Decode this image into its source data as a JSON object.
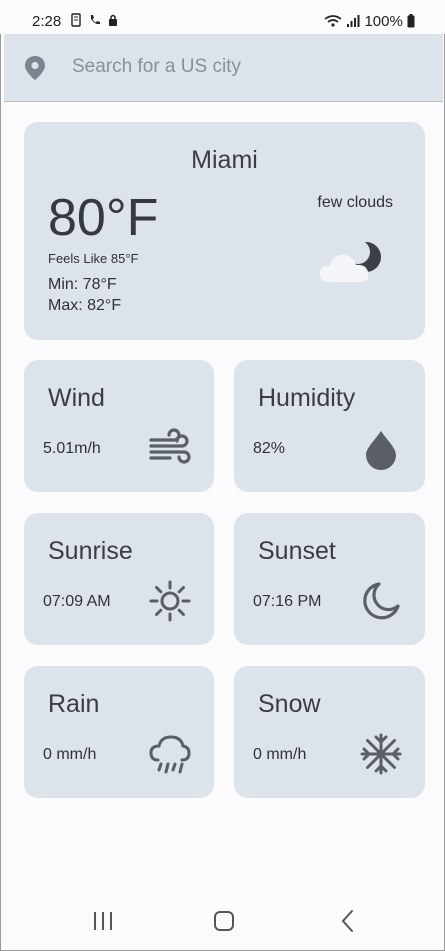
{
  "status_bar": {
    "time": "2:28",
    "battery": "100%"
  },
  "search": {
    "placeholder": "Search for a US city",
    "value": ""
  },
  "current": {
    "city": "Miami",
    "temperature": "80°F",
    "feels_like": "Feels Like 85°F",
    "min": "Min: 78°F",
    "max": "Max: 82°F",
    "description": "few clouds",
    "icon": "partly-cloudy-night-icon"
  },
  "tiles": [
    {
      "title": "Wind",
      "value": "5.01m/h",
      "icon": "wind-icon"
    },
    {
      "title": "Humidity",
      "value": "82%",
      "icon": "drop-icon"
    },
    {
      "title": "Sunrise",
      "value": "07:09 AM",
      "icon": "sun-icon"
    },
    {
      "title": "Sunset",
      "value": "07:16 PM",
      "icon": "moon-icon"
    },
    {
      "title": "Rain",
      "value": "0 mm/h",
      "icon": "rain-cloud-icon"
    },
    {
      "title": "Snow",
      "value": "0 mm/h",
      "icon": "snowflake-icon"
    }
  ],
  "colors": {
    "card": "#dde3ea",
    "icon": "#5a5f66",
    "background": "#fbfbfe"
  }
}
